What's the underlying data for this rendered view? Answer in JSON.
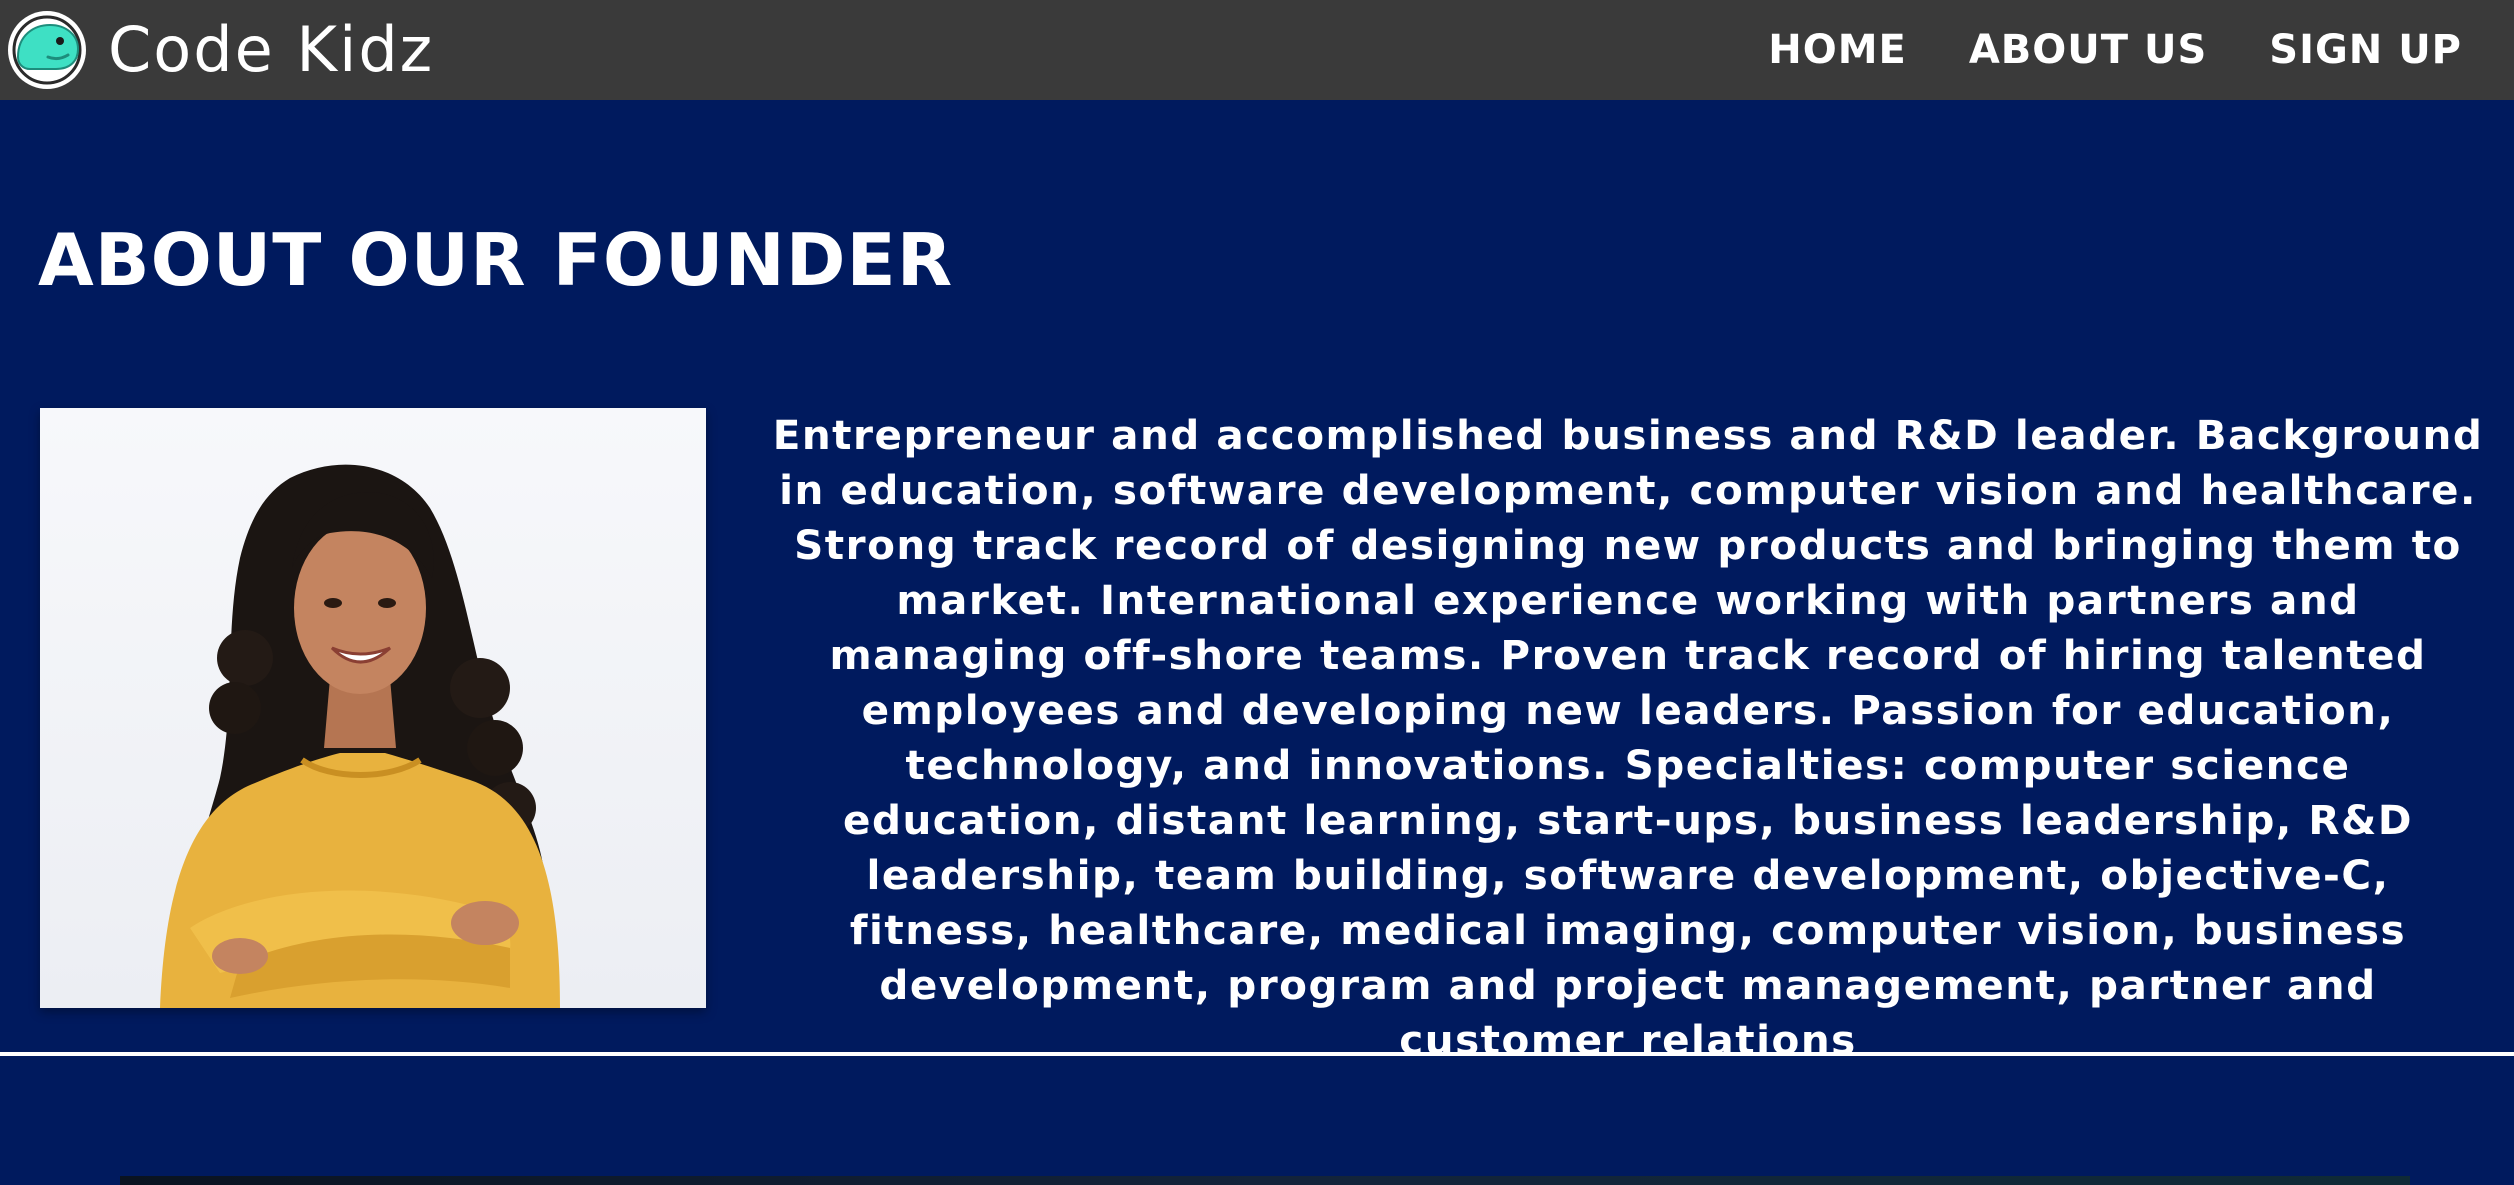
{
  "header": {
    "brand_name": "Code Kidz",
    "logo_icon": "dinosaur-logo-icon",
    "nav": [
      {
        "label": "HOME"
      },
      {
        "label": "ABOUT US"
      },
      {
        "label": "SIGN UP"
      }
    ]
  },
  "main": {
    "title": "ABOUT OUR FOUNDER",
    "bio": "Entrepreneur and accomplished business and R&D leader. Background in education, software development, computer vision and healthcare. Strong track record of designing new products and bringing them to market. International experience working with partners and managing off-shore teams. Proven track record of hiring talented employees and developing new leaders. Passion for education, technology, and innovations. Specialties: computer science education, distant learning, start-ups, business leadership, R&D leadership, team building, software development, objective-C, fitness, healthcare, medical imaging, computer vision, business development, program and project management, partner and customer relations"
  },
  "colors": {
    "header_bg": "#3a3a3a",
    "page_bg": "#001a5e",
    "text": "#ffffff",
    "logo_accent": "#3ee0c4"
  }
}
